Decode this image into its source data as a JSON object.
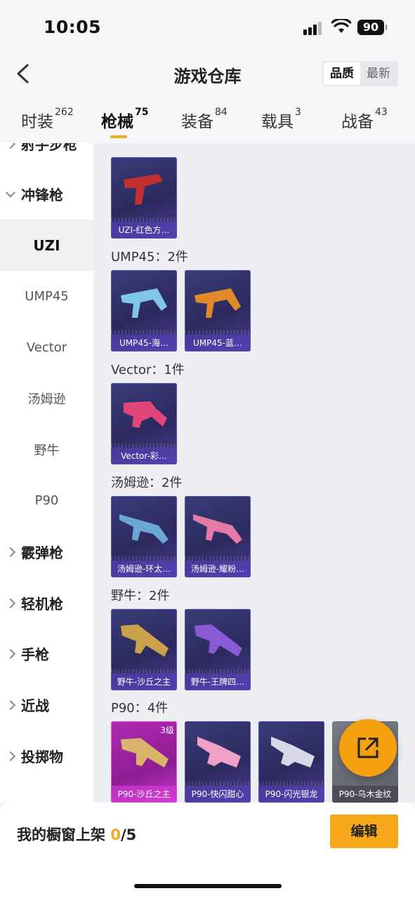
{
  "status": {
    "time": "10:05",
    "battery": "90"
  },
  "header": {
    "title": "游戏仓库",
    "sort_quality": "品质",
    "sort_newest": "最新"
  },
  "tabs": [
    {
      "label": "时装",
      "count": "262"
    },
    {
      "label": "枪械",
      "count": "75"
    },
    {
      "label": "装备",
      "count": "84"
    },
    {
      "label": "载具",
      "count": "3"
    },
    {
      "label": "战备",
      "count": "43"
    }
  ],
  "sidebar": {
    "partial_top": "射手步枪",
    "items": [
      {
        "label": "冲锋枪",
        "type": "category",
        "expanded": true
      },
      {
        "label": "UZI",
        "type": "sub",
        "selected": true
      },
      {
        "label": "UMP45",
        "type": "sub"
      },
      {
        "label": "Vector",
        "type": "sub"
      },
      {
        "label": "汤姆逊",
        "type": "sub"
      },
      {
        "label": "野牛",
        "type": "sub"
      },
      {
        "label": "P90",
        "type": "sub"
      },
      {
        "label": "霰弹枪",
        "type": "category"
      },
      {
        "label": "轻机枪",
        "type": "category"
      },
      {
        "label": "手枪",
        "type": "category"
      },
      {
        "label": "近战",
        "type": "category"
      },
      {
        "label": "投掷物",
        "type": "category"
      }
    ]
  },
  "groups": [
    {
      "title": "UZI：1件",
      "items": [
        {
          "label": "UZI-红色方…",
          "color": "#c0302e"
        }
      ]
    },
    {
      "title": "UMP45：2件",
      "items": [
        {
          "label": "UMP45-海…",
          "color": "#7fc6e8"
        },
        {
          "label": "UMP45-蓝…",
          "color": "#e08a2a"
        }
      ]
    },
    {
      "title": "Vector：1件",
      "items": [
        {
          "label": "Vector-彩…",
          "color": "#e0467a"
        }
      ]
    },
    {
      "title": "汤姆逊：2件",
      "items": [
        {
          "label": "汤姆逊-环太…",
          "color": "#6aa7d6"
        },
        {
          "label": "汤姆逊-耀粉…",
          "color": "#e47aa6"
        }
      ]
    },
    {
      "title": "野牛：2件",
      "items": [
        {
          "label": "野牛-沙丘之主",
          "color": "#c9a24a"
        },
        {
          "label": "野牛-王牌四…",
          "color": "#8a5ad6"
        }
      ]
    },
    {
      "title": "P90：4件",
      "items": [
        {
          "label": "P90-沙丘之主",
          "color": "#d9b46a",
          "level": "3级",
          "rarity": "pink"
        },
        {
          "label": "P90-快闪甜心",
          "color": "#f0a0c6"
        },
        {
          "label": "P90-闪光银龙",
          "color": "#d8d8e8"
        },
        {
          "label": "P90-乌木金纹",
          "color": "#c9a24a",
          "rarity": "grey"
        }
      ]
    }
  ],
  "bottom": {
    "shelf_label": "我的橱窗上架",
    "shelf_current": "0",
    "shelf_total": "/5",
    "edit_label": "编辑"
  }
}
